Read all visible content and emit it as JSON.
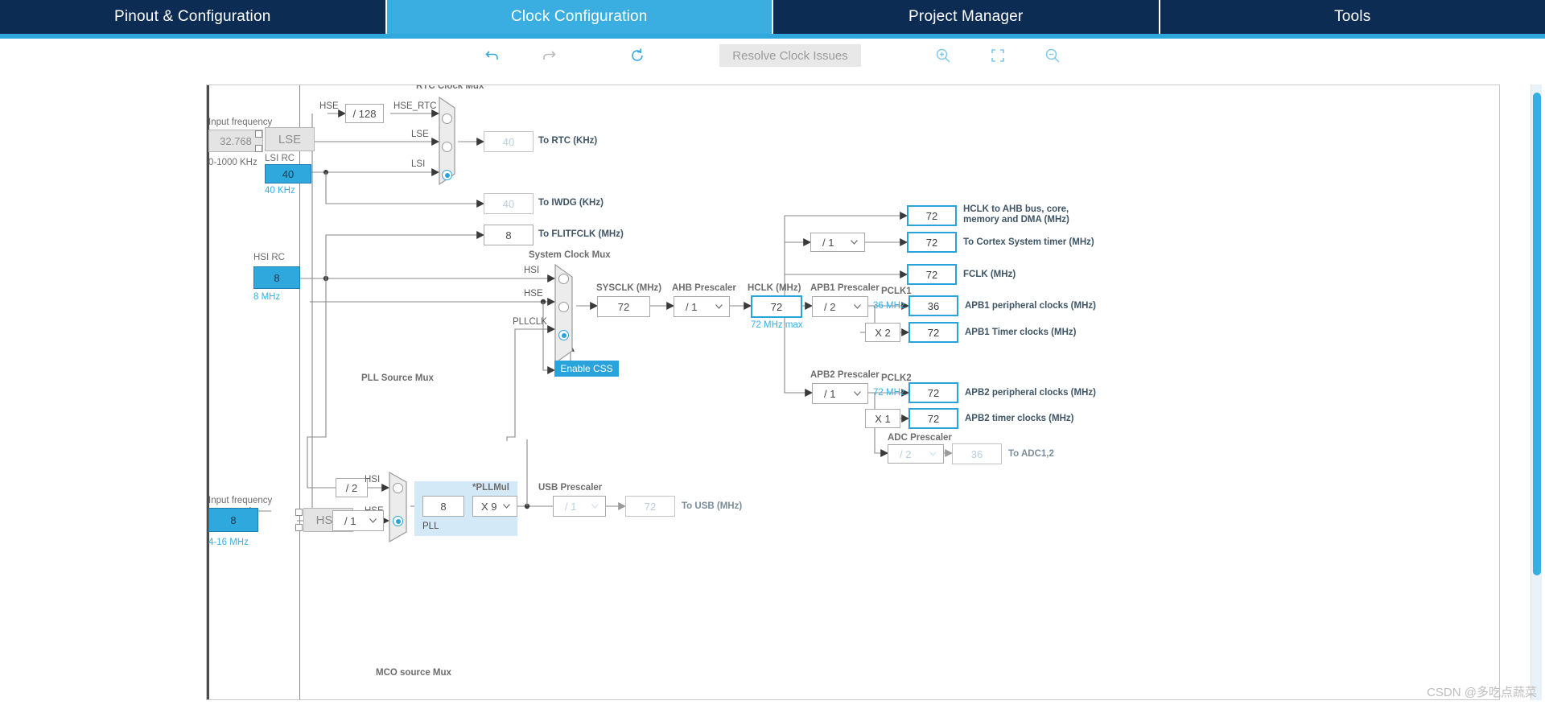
{
  "window": {
    "tabs": [
      {
        "label": "Pinout & Configuration",
        "active": false
      },
      {
        "label": "Clock Configuration",
        "active": true
      },
      {
        "label": "Project Manager",
        "active": false
      },
      {
        "label": "Tools",
        "active": false
      }
    ]
  },
  "toolbar": {
    "undo_icon": "undo-icon",
    "redo_icon": "redo-icon",
    "reset_icon": "reset-icon",
    "resolve_label": "Resolve Clock Issues",
    "zoom_in_icon": "zoom-in-icon",
    "fit_icon": "fit-to-screen-icon",
    "zoom_out_icon": "zoom-out-icon"
  },
  "diagram": {
    "lse": {
      "input_frequency_label": "Input frequency",
      "input_frequency_value": "32.768",
      "range": "0-1000 KHz",
      "osc_label": "LSE"
    },
    "lsi": {
      "title": "LSI RC",
      "value": "40",
      "unit": "40 KHz"
    },
    "hse_rtc_div": {
      "in_label": "HSE",
      "value": "/ 128",
      "out_label": "HSE_RTC"
    },
    "rtc_mux": {
      "title": "RTC Clock Mux",
      "inputs": [
        "HSE_RTC",
        "LSE",
        "LSI"
      ],
      "selected_index": 2
    },
    "to_rtc": {
      "value": "40",
      "label": "To RTC (KHz)"
    },
    "to_iwdg": {
      "value": "40",
      "label": "To IWDG (KHz)"
    },
    "to_flitfclk": {
      "value": "8",
      "label": "To FLITFCLK (MHz)"
    },
    "hsi": {
      "title": "HSI RC",
      "value": "8",
      "unit": "8 MHz"
    },
    "hse": {
      "input_frequency_label": "Input frequency",
      "input_frequency_value": "8",
      "range": "4-16 MHz",
      "osc_label": "HSE",
      "div_value": "/ 1"
    },
    "system_clock_mux": {
      "title": "System Clock Mux",
      "inputs": [
        "HSI",
        "HSE",
        "PLLCLK"
      ],
      "selected_index": 2
    },
    "enable_css": {
      "label": "Enable CSS",
      "state": "on"
    },
    "sysclk": {
      "label": "SYSCLK (MHz)",
      "value": "72"
    },
    "ahb_prescaler": {
      "label": "AHB Prescaler",
      "value": "/ 1"
    },
    "hclk": {
      "label": "HCLK (MHz)",
      "value": "72",
      "max": "72 MHz max"
    },
    "pll_source_mux": {
      "title": "PLL Source Mux",
      "hsi_div": "/ 2",
      "inputs": [
        "HSI",
        "HSE"
      ],
      "selected_index": 1
    },
    "pll": {
      "group_label": "PLL",
      "input_value": "8",
      "mul_label": "*PLLMul",
      "mul_value": "X 9"
    },
    "usb_prescaler": {
      "label": "USB Prescaler",
      "value": "/ 1"
    },
    "to_usb": {
      "value": "72",
      "label": "To USB (MHz)"
    },
    "hclk_outputs": [
      {
        "value": "72",
        "label": "HCLK to AHB bus, core,\nmemory and DMA (MHz)"
      },
      {
        "value": "72",
        "label": "To Cortex System timer (MHz)"
      },
      {
        "value": "72",
        "label": "FCLK (MHz)"
      }
    ],
    "cortex_prescaler": {
      "value": "/ 1"
    },
    "apb1": {
      "prescaler_label": "APB1 Prescaler",
      "prescaler_value": "/ 2",
      "pclk_label": "PCLK1",
      "max": "36 MHz max",
      "peripheral_value": "36",
      "peripheral_label": "APB1 peripheral clocks (MHz)",
      "timer_mul": "X 2",
      "timer_value": "72",
      "timer_label": "APB1 Timer clocks (MHz)"
    },
    "apb2": {
      "prescaler_label": "APB2 Prescaler",
      "prescaler_value": "/ 1",
      "pclk_label": "PCLK2",
      "max": "72 MHz max",
      "peripheral_value": "72",
      "peripheral_label": "APB2 peripheral clocks (MHz)",
      "timer_mul": "X 1",
      "timer_value": "72",
      "timer_label": "APB2 timer clocks (MHz)"
    },
    "adc": {
      "prescaler_label": "ADC Prescaler",
      "prescaler_value": "/ 2",
      "value": "36",
      "label": "To ADC1,2"
    },
    "mco_source_mux": {
      "title": "MCO source Mux"
    }
  },
  "watermark": "CSDN @多吃点蔬菜",
  "colors": {
    "tab_inactive": "#0d2c54",
    "tab_active": "#3aaee0",
    "accent": "#29a3db",
    "header_band": "#2fa8dd"
  }
}
